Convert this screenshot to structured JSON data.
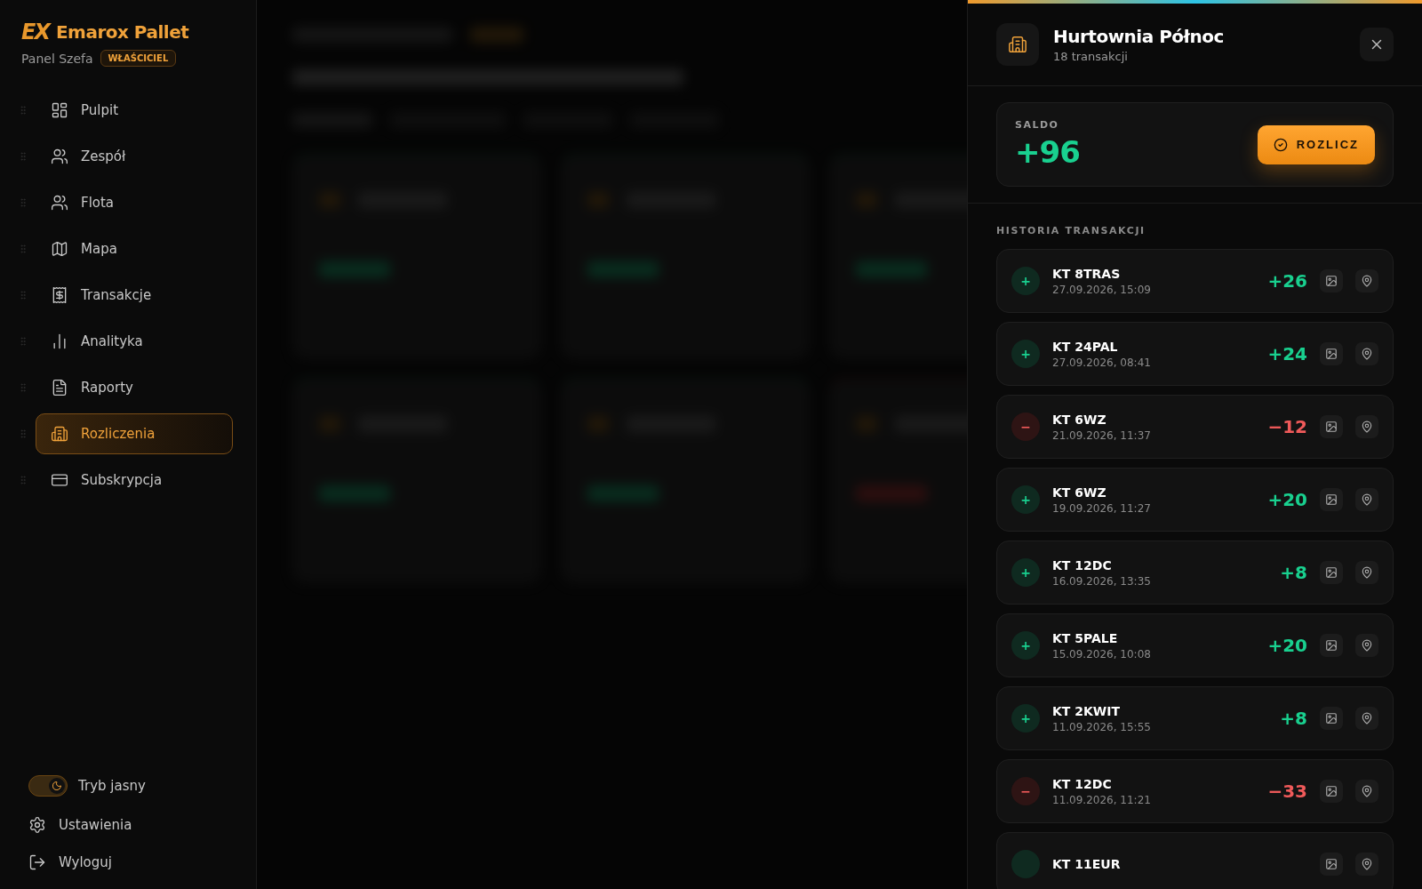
{
  "sidebar": {
    "brand": {
      "mark": "EX",
      "name": "Emarox Pallet"
    },
    "subtitle": "Panel Szefa",
    "role_badge": "WŁAŚCICIEL",
    "items": [
      {
        "label": "Pulpit",
        "selected": false
      },
      {
        "label": "Zespół",
        "selected": false
      },
      {
        "label": "Flota",
        "selected": false
      },
      {
        "label": "Mapa",
        "selected": false
      },
      {
        "label": "Transakcje",
        "selected": false
      },
      {
        "label": "Analityka",
        "selected": false
      },
      {
        "label": "Raporty",
        "selected": false
      },
      {
        "label": "Rozliczenia",
        "selected": true
      },
      {
        "label": "Subskrypcja",
        "selected": false
      }
    ],
    "theme_toggle": {
      "label": "Tryb jasny",
      "on": true
    },
    "footer": [
      {
        "label": "Ustawienia"
      },
      {
        "label": "Wyloguj"
      }
    ]
  },
  "drawer": {
    "title": "Hurtownia Północ",
    "subtitle": "18 transakcji",
    "balance": {
      "label": "SALDO",
      "value": "+96",
      "kind": "credit"
    },
    "settle_button": "ROZLICZ",
    "history_title": "HISTORIA TRANSAKCJI",
    "transactions": [
      {
        "kind": "credit",
        "badge": "+",
        "code": "KT 8TRAS",
        "date": "27.09.2026, 15:09",
        "amount": "+26"
      },
      {
        "kind": "credit",
        "badge": "+",
        "code": "KT 24PAL",
        "date": "27.09.2026, 08:41",
        "amount": "+24"
      },
      {
        "kind": "debit",
        "badge": "−",
        "code": "KT 6WZ",
        "date": "21.09.2026, 11:37",
        "amount": "−12"
      },
      {
        "kind": "credit",
        "badge": "+",
        "code": "KT 6WZ",
        "date": "19.09.2026, 11:27",
        "amount": "+20"
      },
      {
        "kind": "credit",
        "badge": "+",
        "code": "KT 12DC",
        "date": "16.09.2026, 13:35",
        "amount": "+8"
      },
      {
        "kind": "credit",
        "badge": "+",
        "code": "KT 5PALE",
        "date": "15.09.2026, 10:08",
        "amount": "+20"
      },
      {
        "kind": "credit",
        "badge": "+",
        "code": "KT 2KWIT",
        "date": "11.09.2026, 15:55",
        "amount": "+8"
      },
      {
        "kind": "debit",
        "badge": "−",
        "code": "KT 12DC",
        "date": "11.09.2026, 11:21",
        "amount": "−33"
      },
      {
        "kind": "credit",
        "code": "KT 11EUR"
      }
    ]
  }
}
